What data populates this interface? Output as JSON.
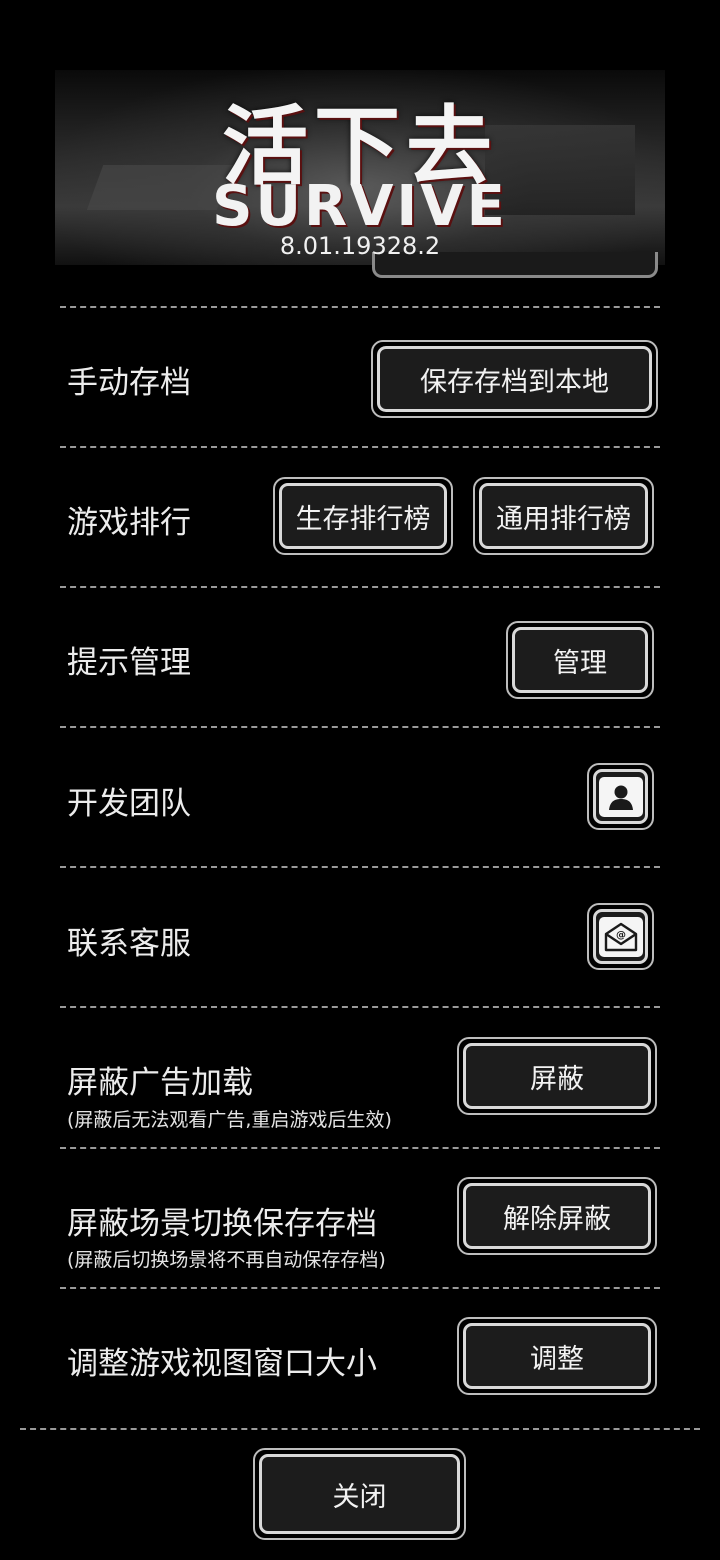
{
  "header": {
    "logo_cn": "活下去",
    "logo_en": "SURVIVE",
    "version": "8.01.19328.2"
  },
  "rows": {
    "manual_save": {
      "label": "手动存档",
      "button": "保存存档到本地"
    },
    "ranking": {
      "label": "游戏排行",
      "button_survival": "生存排行榜",
      "button_general": "通用排行榜"
    },
    "tips": {
      "label": "提示管理",
      "button": "管理"
    },
    "dev_team": {
      "label": "开发团队",
      "icon": "person-icon"
    },
    "support": {
      "label": "联系客服",
      "icon": "mail-icon"
    },
    "block_ads": {
      "label": "屏蔽广告加载",
      "sub": "(屏蔽后无法观看广告,重启游戏后生效)",
      "button": "屏蔽"
    },
    "block_scene_save": {
      "label": "屏蔽场景切换保存存档",
      "sub": "(屏蔽后切换场景将不再自动保存存档)",
      "button": "解除屏蔽"
    },
    "window_size": {
      "label": "调整游戏视图窗口大小",
      "button": "调整"
    }
  },
  "footer": {
    "close": "关闭"
  },
  "colors": {
    "background": "#000000",
    "text": "#ececec",
    "button_fill": "#1c1c1c",
    "button_border": "#d9d9d9"
  }
}
